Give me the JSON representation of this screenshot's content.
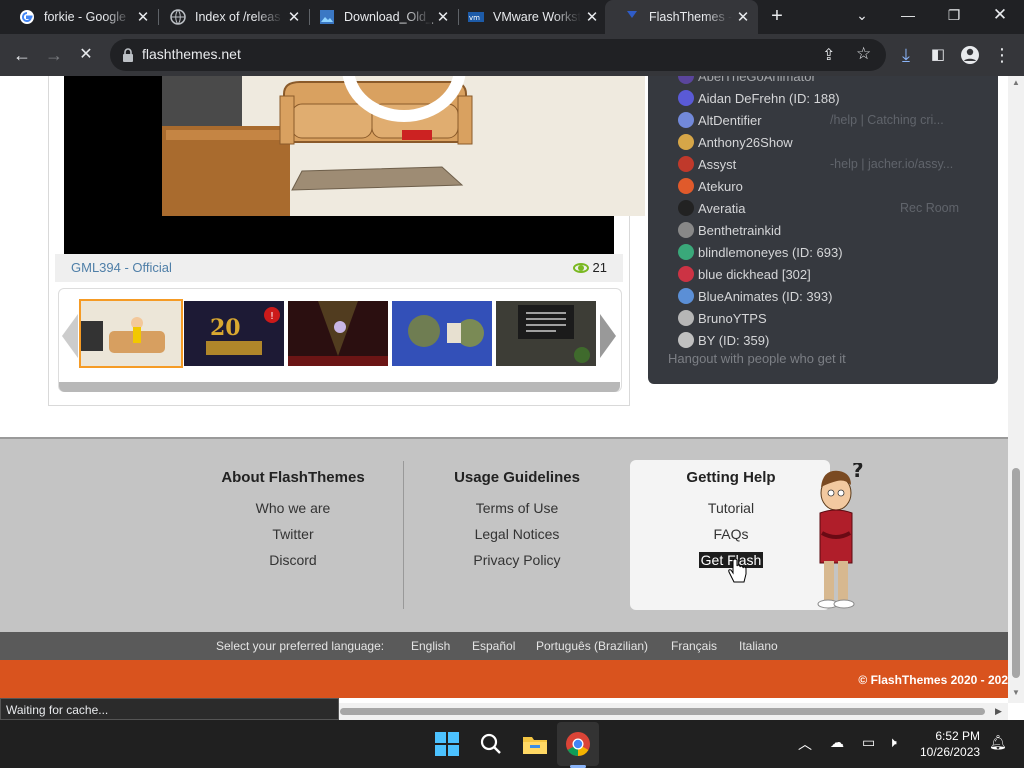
{
  "browser": {
    "tabs": [
      {
        "title": "forkie - Google",
        "icon": "google-icon"
      },
      {
        "title": "Index of /releas",
        "icon": "globe-icon"
      },
      {
        "title": "Download_Old_",
        "icon": "image-icon"
      },
      {
        "title": "VMware Workst",
        "icon": "vmware-icon"
      },
      {
        "title": "FlashThemes - ",
        "icon": "flashthemes-icon",
        "active": true
      }
    ],
    "url": "flashthemes.net",
    "status_text": "Waiting for cache..."
  },
  "video": {
    "author": "GML394 - Official",
    "views": "21"
  },
  "discord": {
    "members": [
      {
        "name": "AbelTheGoAnimator",
        "game": ""
      },
      {
        "name": "Aidan DeFrehn (ID: 188)",
        "game": ""
      },
      {
        "name": "AltDentifier",
        "game": "/help | Catching cri..."
      },
      {
        "name": "Anthony26Show",
        "game": ""
      },
      {
        "name": "Assyst",
        "game": "-help | jacher.io/assy..."
      },
      {
        "name": "Atekuro",
        "game": ""
      },
      {
        "name": "Averatia",
        "game": "Rec Room"
      },
      {
        "name": "Benthetrainkid",
        "game": ""
      },
      {
        "name": "blindlemoneyes (ID: 693)",
        "game": ""
      },
      {
        "name": "blue dickhead [302]",
        "game": ""
      },
      {
        "name": "BlueAnimates (ID: 393)",
        "game": ""
      },
      {
        "name": "BrunoYTPS",
        "game": ""
      },
      {
        "name": "BY (ID: 359)",
        "game": ""
      }
    ],
    "footer": "Hangout with people who get it"
  },
  "footer": {
    "about": {
      "title": "About FlashThemes",
      "links": [
        "Who we are",
        "Twitter",
        "Discord"
      ]
    },
    "usage": {
      "title": "Usage Guidelines",
      "links": [
        "Terms of Use",
        "Legal Notices",
        "Privacy Policy"
      ]
    },
    "help": {
      "title": "Getting Help",
      "links": [
        "Tutorial",
        "FAQs",
        "Get Flash"
      ]
    },
    "language_label": "Select your preferred language:",
    "languages": [
      "English",
      "Español",
      "Português (Brazilian)",
      "Français",
      "Italiano"
    ],
    "copyright": "© FlashThemes 2020 - 202"
  },
  "taskbar": {
    "time": "6:52 PM",
    "date": "10/26/2023"
  }
}
